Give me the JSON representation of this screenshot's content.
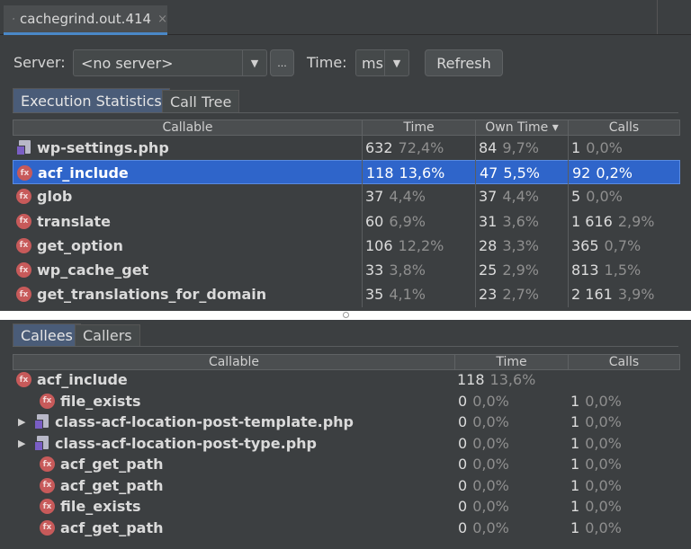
{
  "file_tab": {
    "title": "cachegrind.out.414",
    "close": "×"
  },
  "toolbar": {
    "server_label": "Server:",
    "server_value": "<no server>",
    "ellipsis": "...",
    "time_label": "Time:",
    "time_unit": "ms",
    "refresh_label": "Refresh"
  },
  "top_tabs": [
    "Execution Statistics",
    "Call Tree"
  ],
  "stats_table": {
    "columns": [
      "Callable",
      "Time",
      "Own Time ▾",
      "Calls"
    ],
    "rows": [
      {
        "icon": "php-file-icon",
        "name": "wp-settings.php",
        "time": "632",
        "time_pct": "72,4%",
        "own": "84",
        "own_pct": "9,7%",
        "calls": "1",
        "calls_pct": "0,0%",
        "selected": false
      },
      {
        "icon": "function-icon",
        "name": "acf_include",
        "time": "118",
        "time_pct": "13,6%",
        "own": "47",
        "own_pct": "5,5%",
        "calls": "92",
        "calls_pct": "0,2%",
        "selected": true
      },
      {
        "icon": "function-icon",
        "name": "glob",
        "time": "37",
        "time_pct": "4,4%",
        "own": "37",
        "own_pct": "4,4%",
        "calls": "5",
        "calls_pct": "0,0%",
        "selected": false
      },
      {
        "icon": "function-icon",
        "name": "translate",
        "time": "60",
        "time_pct": "6,9%",
        "own": "31",
        "own_pct": "3,6%",
        "calls": "1 616",
        "calls_pct": "2,9%",
        "selected": false
      },
      {
        "icon": "function-icon",
        "name": "get_option",
        "time": "106",
        "time_pct": "12,2%",
        "own": "28",
        "own_pct": "3,3%",
        "calls": "365",
        "calls_pct": "0,7%",
        "selected": false
      },
      {
        "icon": "function-icon",
        "name": "wp_cache_get",
        "time": "33",
        "time_pct": "3,8%",
        "own": "25",
        "own_pct": "2,9%",
        "calls": "813",
        "calls_pct": "1,5%",
        "selected": false
      },
      {
        "icon": "function-icon",
        "name": "get_translations_for_domain",
        "time": "35",
        "time_pct": "4,1%",
        "own": "23",
        "own_pct": "2,7%",
        "calls": "2 161",
        "calls_pct": "3,9%",
        "selected": false
      }
    ]
  },
  "bottom_tabs": [
    "Callees",
    "Callers"
  ],
  "callees_table": {
    "columns": [
      "Callable",
      "Time",
      "Calls"
    ],
    "root": {
      "icon": "function-icon",
      "name": "acf_include",
      "time": "118",
      "time_pct": "13,6%"
    },
    "rows": [
      {
        "icon": "function-icon",
        "name": "file_exists",
        "expandable": false,
        "time": "0",
        "time_pct": "0,0%",
        "calls": "1",
        "calls_pct": "0,0%"
      },
      {
        "icon": "php-file-icon",
        "name": "class-acf-location-post-template.php",
        "expandable": true,
        "time": "0",
        "time_pct": "0,0%",
        "calls": "1",
        "calls_pct": "0,0%"
      },
      {
        "icon": "php-file-icon",
        "name": "class-acf-location-post-type.php",
        "expandable": true,
        "time": "0",
        "time_pct": "0,0%",
        "calls": "1",
        "calls_pct": "0,0%"
      },
      {
        "icon": "function-icon",
        "name": "acf_get_path",
        "expandable": false,
        "time": "0",
        "time_pct": "0,0%",
        "calls": "1",
        "calls_pct": "0,0%"
      },
      {
        "icon": "function-icon",
        "name": "acf_get_path",
        "expandable": false,
        "time": "0",
        "time_pct": "0,0%",
        "calls": "1",
        "calls_pct": "0,0%"
      },
      {
        "icon": "function-icon",
        "name": "file_exists",
        "expandable": false,
        "time": "0",
        "time_pct": "0,0%",
        "calls": "1",
        "calls_pct": "0,0%"
      },
      {
        "icon": "function-icon",
        "name": "acf_get_path",
        "expandable": false,
        "time": "0",
        "time_pct": "0,0%",
        "calls": "1",
        "calls_pct": "0,0%"
      }
    ]
  },
  "colors": {
    "selection": "#2f65ca",
    "active_tab": "#4a5c78",
    "function_icon": "#c75a5a",
    "php_icon": "#7a5ec5"
  },
  "icons": {
    "fx_glyph": "fx",
    "expand_glyph": "▶",
    "dropdown_glyph": "▼"
  }
}
